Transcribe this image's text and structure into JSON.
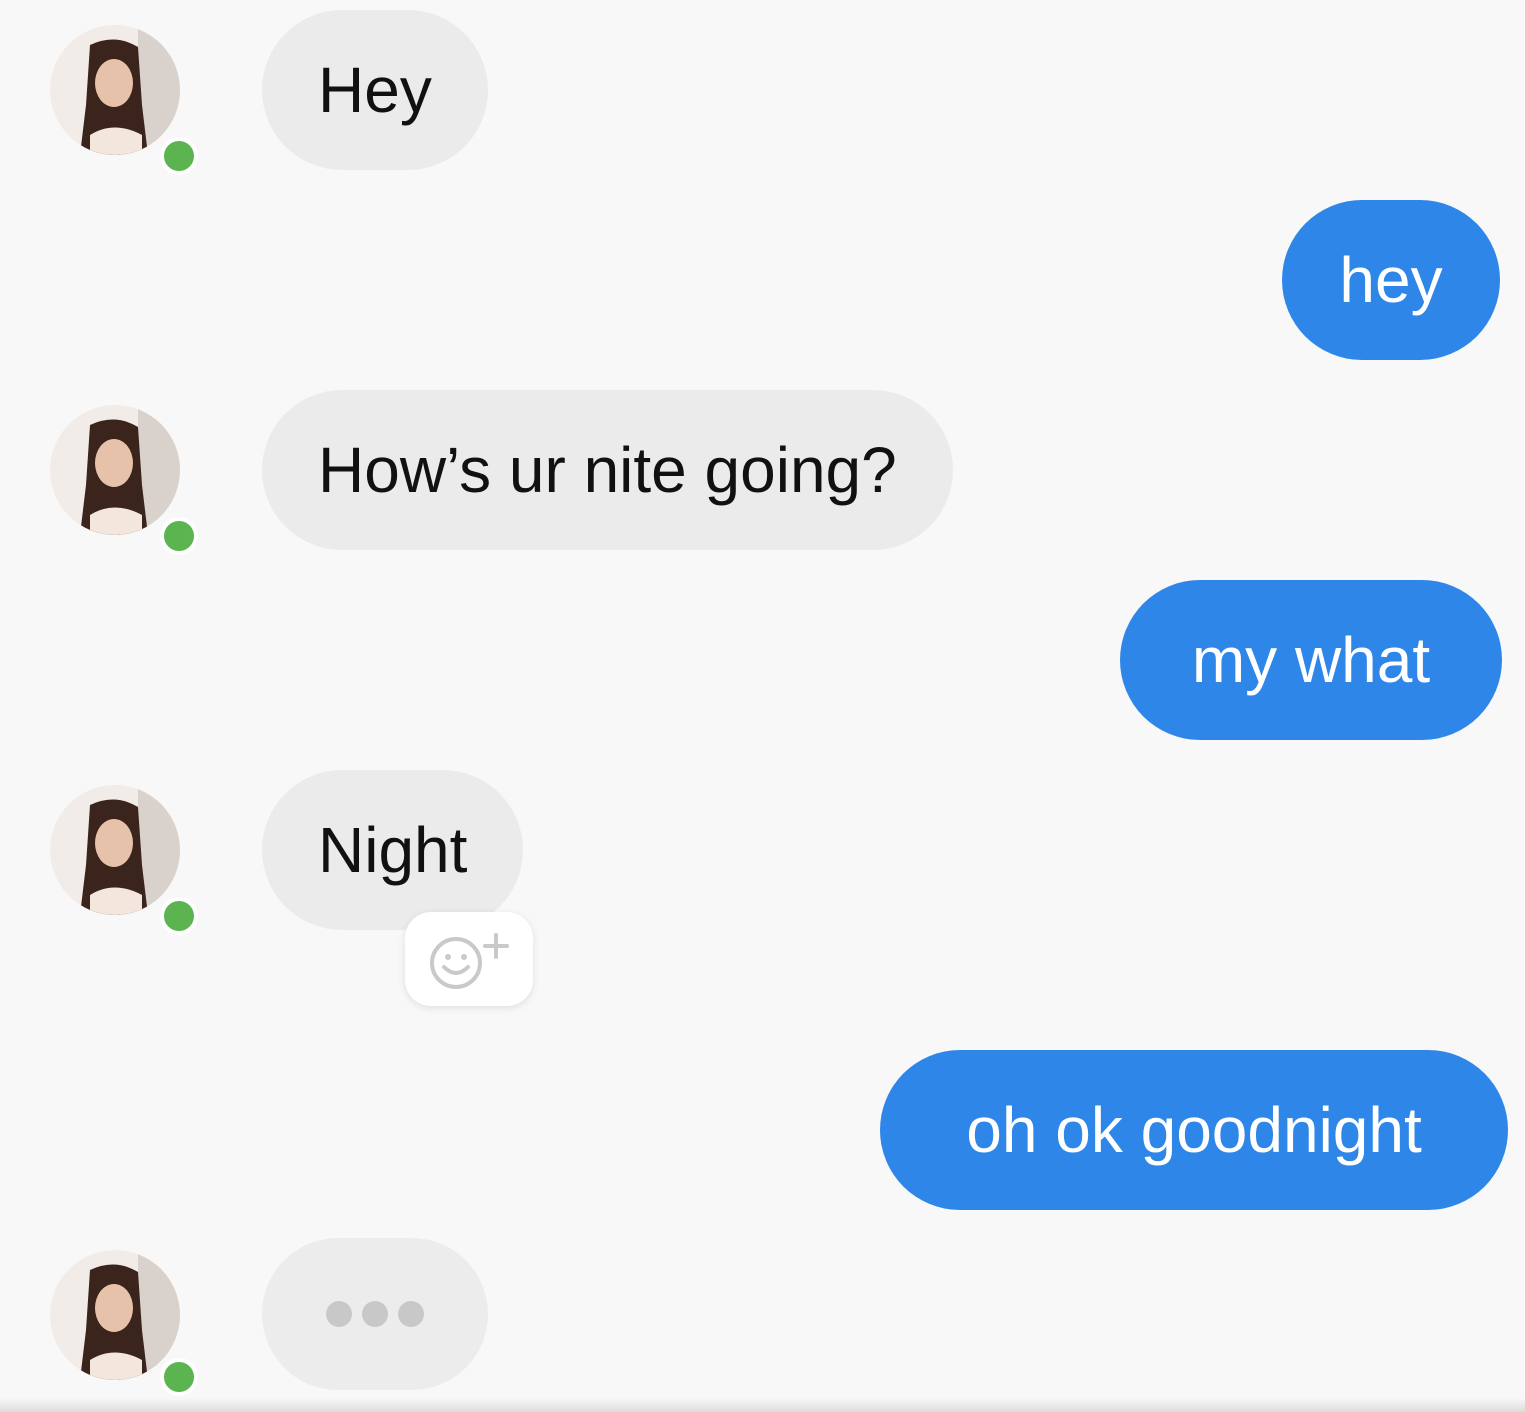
{
  "theme": {
    "incoming_bubble_color": "#ebebeb",
    "outgoing_bubble_color": "#2e87e8",
    "presence_color": "#5bb450",
    "background": "#f8f8f8"
  },
  "messages": [
    {
      "sender": "contact",
      "text": "Hey"
    },
    {
      "sender": "me",
      "text": "hey"
    },
    {
      "sender": "contact",
      "text": "How’s ur nite going?"
    },
    {
      "sender": "me",
      "text": "my what"
    },
    {
      "sender": "contact",
      "text": "Night"
    },
    {
      "sender": "me",
      "text": "oh ok goodnight"
    }
  ],
  "reaction_button": {
    "icon": "add-reaction-icon"
  },
  "typing_indicator": {
    "icon": "typing-dots"
  },
  "contact": {
    "status": "online",
    "avatar_icon": "contact-avatar-photo"
  }
}
